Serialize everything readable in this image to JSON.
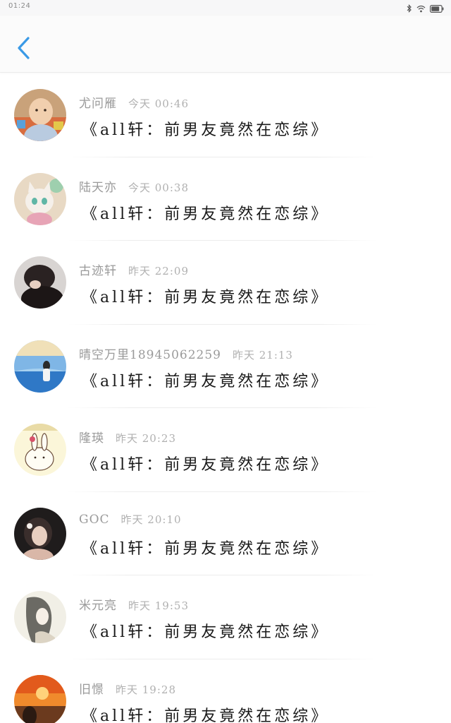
{
  "status_bar": {
    "time": "01:24"
  },
  "header": {
    "back_icon": "chevron-left-icon",
    "accent_color": "#3a9ae6"
  },
  "comments": [
    {
      "name": "尤问雁",
      "time": "今天 00:46",
      "text": "《all轩：前男友竟然在恋综》"
    },
    {
      "name": "陆天亦",
      "time": "今天 00:38",
      "text": "《all轩：前男友竟然在恋综》"
    },
    {
      "name": "古迹轩",
      "time": "昨天 22:09",
      "text": "《all轩：前男友竟然在恋综》"
    },
    {
      "name": "晴空万里18945062259",
      "time": "昨天 21:13",
      "text": "《all轩：前男友竟然在恋综》"
    },
    {
      "name": "隆瑛",
      "time": "昨天 20:23",
      "text": "《all轩：前男友竟然在恋综》"
    },
    {
      "name": "GOC",
      "time": "昨天 20:10",
      "text": "《all轩：前男友竟然在恋综》"
    },
    {
      "name": "米元亮",
      "time": "昨天 19:53",
      "text": "《all轩：前男友竟然在恋综》"
    },
    {
      "name": "旧憬",
      "time": "昨天 19:28",
      "text": "《all轩：前男友竟然在恋综》"
    }
  ]
}
